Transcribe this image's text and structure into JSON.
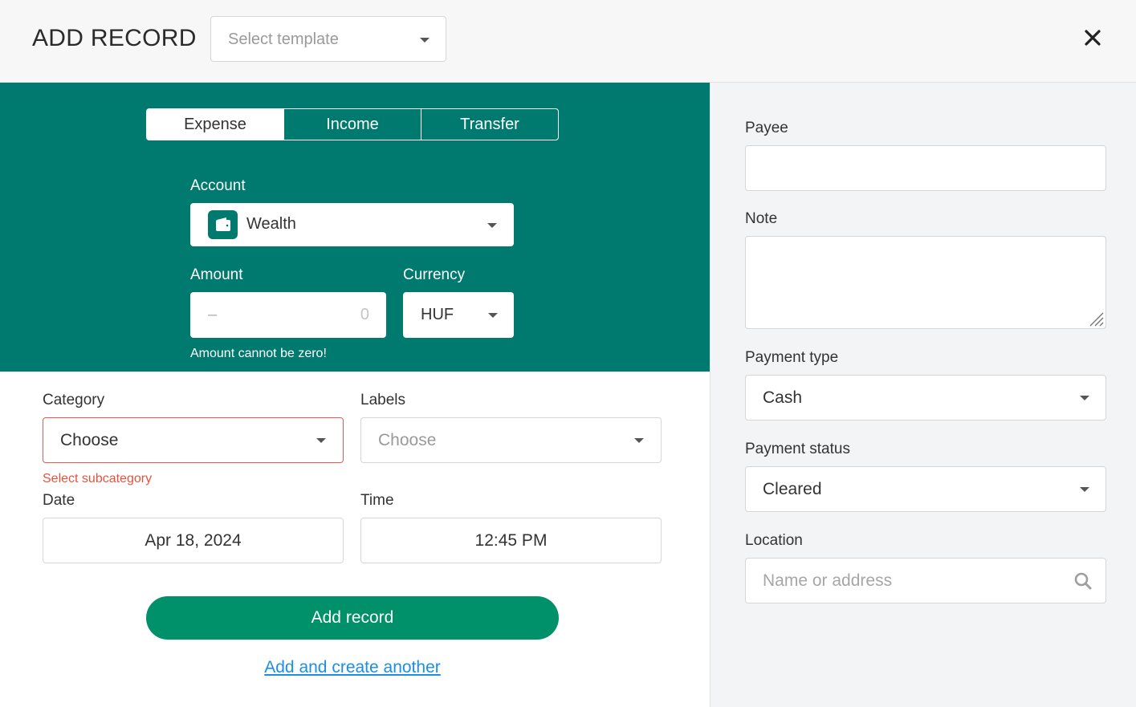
{
  "header": {
    "title": "ADD RECORD",
    "template_placeholder": "Select template",
    "close_icon": "close-icon"
  },
  "tabs": [
    {
      "label": "Expense",
      "active": true
    },
    {
      "label": "Income",
      "active": false
    },
    {
      "label": "Transfer",
      "active": false
    }
  ],
  "account": {
    "label": "Account",
    "value": "Wealth",
    "icon": "wallet-icon"
  },
  "amount": {
    "label": "Amount",
    "sign": "–",
    "value": "0",
    "error": "Amount cannot be zero!"
  },
  "currency": {
    "label": "Currency",
    "value": "HUF"
  },
  "category": {
    "label": "Category",
    "value": "Choose",
    "error": "Select subcategory"
  },
  "labels": {
    "label": "Labels",
    "placeholder": "Choose"
  },
  "date": {
    "label": "Date",
    "value": "Apr 18, 2024"
  },
  "time": {
    "label": "Time",
    "value": "12:45 PM"
  },
  "actions": {
    "add_record": "Add record",
    "add_another": "Add and create another"
  },
  "right": {
    "payee": {
      "label": "Payee",
      "value": ""
    },
    "note": {
      "label": "Note",
      "value": ""
    },
    "payment_type": {
      "label": "Payment type",
      "value": "Cash"
    },
    "payment_status": {
      "label": "Payment status",
      "value": "Cleared"
    },
    "location": {
      "label": "Location",
      "placeholder": "Name or address",
      "icon": "search-icon"
    }
  },
  "colors": {
    "primary_green": "#007a6e",
    "button_green": "#00916a",
    "error_red": "#e5533d",
    "link_blue": "#1a8fe3"
  }
}
